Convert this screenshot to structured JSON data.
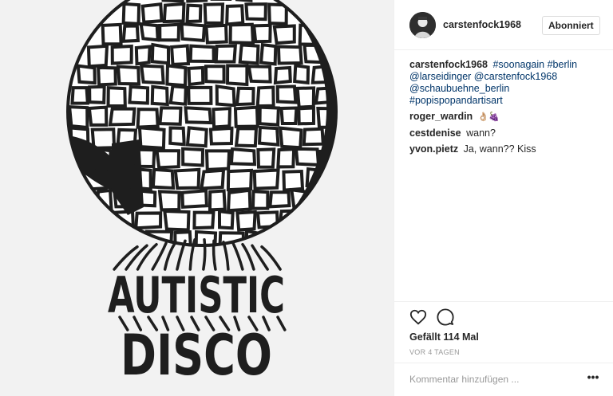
{
  "post": {
    "image_icon": "disco-ball-drawing",
    "image_text_line1": "AUTISTIC",
    "image_text_line2": "DISCO"
  },
  "header": {
    "avatar_icon": "user-avatar",
    "username": "carstenfock1968",
    "follow_label": "Abonniert"
  },
  "caption": {
    "username": "carstenfock1968",
    "tags": [
      "#soonagain",
      "#berlin",
      "@larseidinger",
      "@carstenfock1968",
      "@schaubuehne_berlin",
      "#popispopandartisart"
    ]
  },
  "comments": [
    {
      "username": "roger_wardin",
      "text": "👌🏼🍇"
    },
    {
      "username": "cestdenise",
      "text": "wann?"
    },
    {
      "username": "yvon.pietz",
      "text": "Ja, wann?? Kiss"
    }
  ],
  "actions": {
    "like_icon": "heart-outline",
    "comment_icon": "speech-bubble",
    "likes_text": "Gefällt 114 Mal",
    "time_text": "VOR 4 TAGEN"
  },
  "add_comment": {
    "placeholder": "Kommentar hinzufügen ...",
    "more_label": "•••"
  }
}
